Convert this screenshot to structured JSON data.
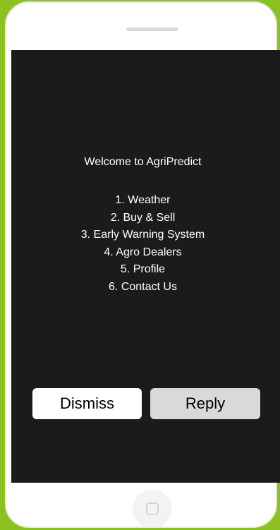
{
  "screen": {
    "welcome_text": "Welcome to AgriPredict",
    "menu_items": [
      "1. Weather",
      "2. Buy & Sell",
      "3. Early Warning System",
      "4. Agro Dealers",
      "5. Profile",
      "6. Contact Us"
    ]
  },
  "actions": {
    "dismiss_label": "Dismiss",
    "reply_label": "Reply"
  },
  "colors": {
    "background_accent": "#8cc21f",
    "screen_background": "#1b1b1b",
    "dismiss_button": "#ffffff",
    "reply_button": "#d9d9d9"
  }
}
